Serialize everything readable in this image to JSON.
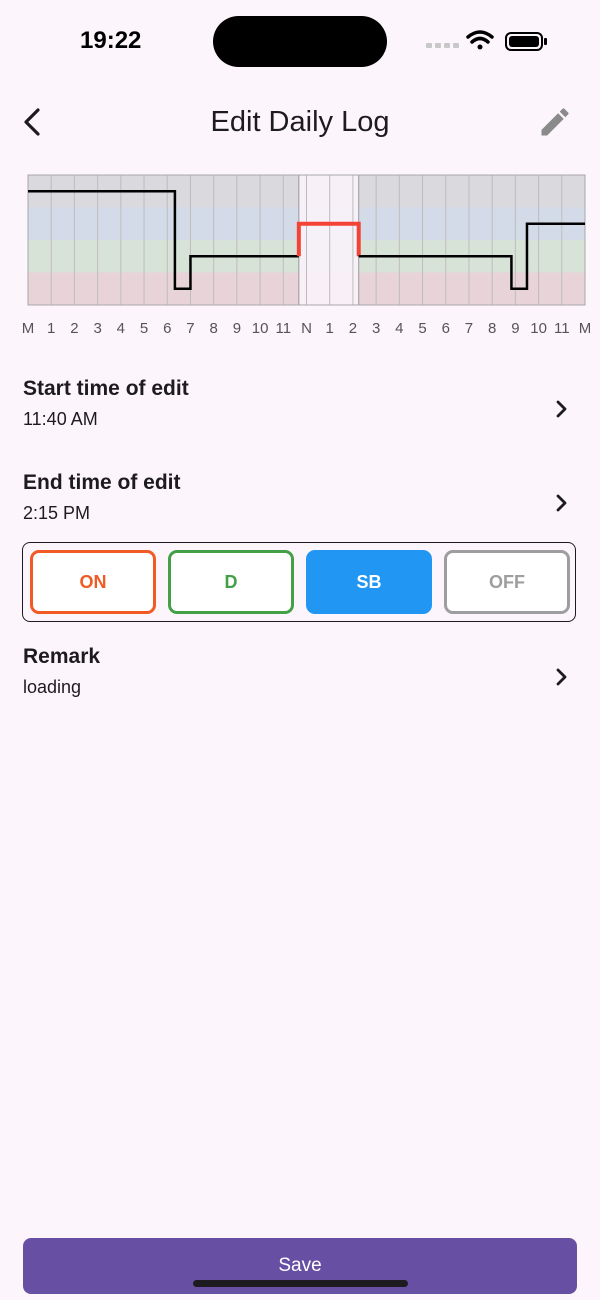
{
  "status_bar": {
    "time": "19:22"
  },
  "app_bar": {
    "title": "Edit Daily Log"
  },
  "chart_data": {
    "type": "line",
    "title": "",
    "xlabel": "",
    "ylabel": "",
    "tick_labels": [
      "M",
      "1",
      "2",
      "3",
      "4",
      "5",
      "6",
      "7",
      "8",
      "9",
      "10",
      "11",
      "N",
      "1",
      "2",
      "3",
      "4",
      "5",
      "6",
      "7",
      "8",
      "9",
      "10",
      "11",
      "M"
    ],
    "xlim": [
      0,
      24
    ],
    "rows": [
      "OFF",
      "SB",
      "D",
      "ON"
    ],
    "grid": true,
    "highlight_range": [
      11.67,
      14.25
    ],
    "series": [
      {
        "color": "#000000",
        "points": [
          [
            0,
            "OFF"
          ],
          [
            6.33,
            "OFF"
          ],
          [
            6.33,
            "ON"
          ],
          [
            7,
            "ON"
          ],
          [
            7,
            "D"
          ],
          [
            11.67,
            "D"
          ]
        ]
      },
      {
        "color": "#f44336",
        "points": [
          [
            11.67,
            "D"
          ],
          [
            11.67,
            "SB"
          ],
          [
            14.25,
            "SB"
          ],
          [
            14.25,
            "D"
          ]
        ]
      },
      {
        "color": "#000000",
        "points": [
          [
            14.25,
            "D"
          ],
          [
            20.83,
            "D"
          ],
          [
            20.83,
            "ON"
          ],
          [
            21.5,
            "ON"
          ],
          [
            21.5,
            "SB"
          ],
          [
            24,
            "SB"
          ]
        ]
      }
    ]
  },
  "form": {
    "start": {
      "title": "Start time of edit",
      "value": "11:40 AM"
    },
    "end": {
      "title": "End time of edit",
      "value": "2:15 PM"
    },
    "remark": {
      "title": "Remark",
      "value": "loading"
    }
  },
  "status_options": [
    {
      "label": "ON",
      "color": "#f15a24",
      "selected": false
    },
    {
      "label": "D",
      "color": "#43a047",
      "selected": false
    },
    {
      "label": "SB",
      "color": "#2196f3",
      "selected": true
    },
    {
      "label": "OFF",
      "color": "#9e9e9e",
      "selected": false
    }
  ],
  "save_label": "Save"
}
